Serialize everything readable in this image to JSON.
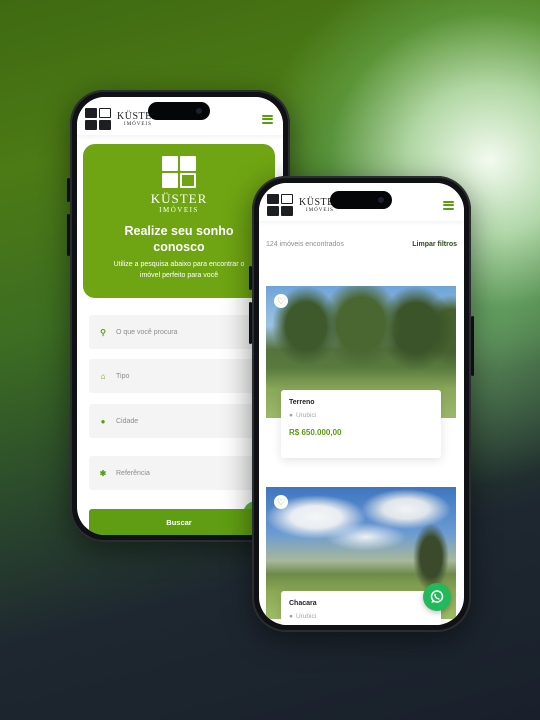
{
  "brand": {
    "name": "KÜSTER",
    "tagline": "IMÓVEIS"
  },
  "left_phone": {
    "hero": {
      "title": "Realize seu sonho conosco",
      "subtitle": "Utilize a pesquisa abaixo para encontrar o imóvel perfeito para você"
    },
    "fields": [
      {
        "icon": "search-icon",
        "placeholder": "O que você procura"
      },
      {
        "icon": "home-icon",
        "placeholder": "Tipo"
      },
      {
        "icon": "map-pin-icon",
        "placeholder": "Cidade"
      },
      {
        "icon": "asterisk-icon",
        "placeholder": "Referência"
      }
    ],
    "search_button": "Buscar"
  },
  "right_phone": {
    "results_count": "124 imóveis encontrados",
    "clear_filters": "Limpar filtros",
    "listings": [
      {
        "type": "Terreno",
        "location": "Urubici",
        "price": "R$ 650.000,00"
      },
      {
        "type": "Chacara",
        "location": "Urubici",
        "price": ""
      }
    ]
  },
  "colors": {
    "brand_green": "#6fa513",
    "dark_text": "#1d1f22",
    "whatsapp": "#22b85c"
  }
}
